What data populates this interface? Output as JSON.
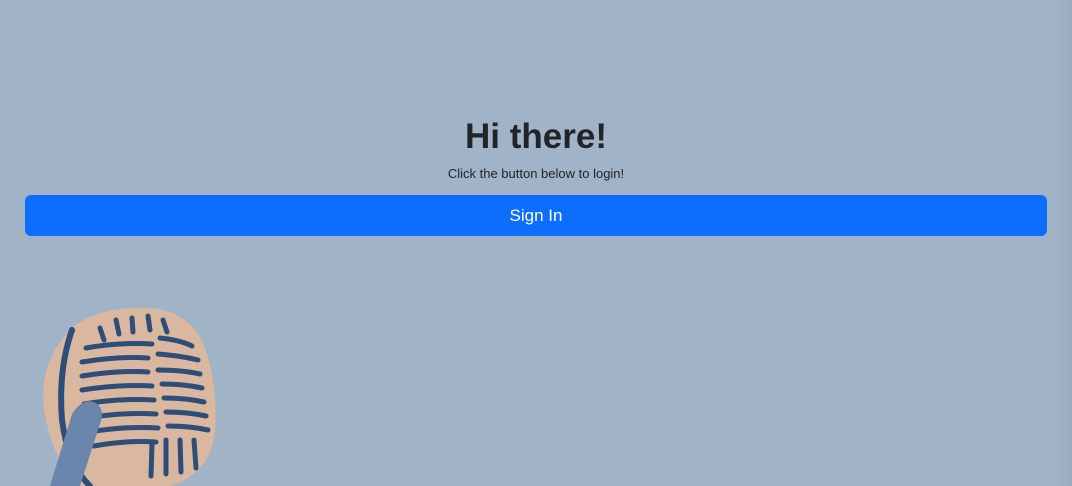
{
  "login": {
    "title": "Hi there!",
    "subtitle": "Click the button below to login!",
    "signin_label": "Sign In"
  },
  "colors": {
    "background": "#a1b3c6",
    "button": "#0d6efd",
    "text": "#212529",
    "mic_head": "#dab8a0",
    "mic_lines": "#2e4d78",
    "mic_handle": "#6a86ad"
  },
  "illustration": {
    "icon": "microphone-icon"
  }
}
